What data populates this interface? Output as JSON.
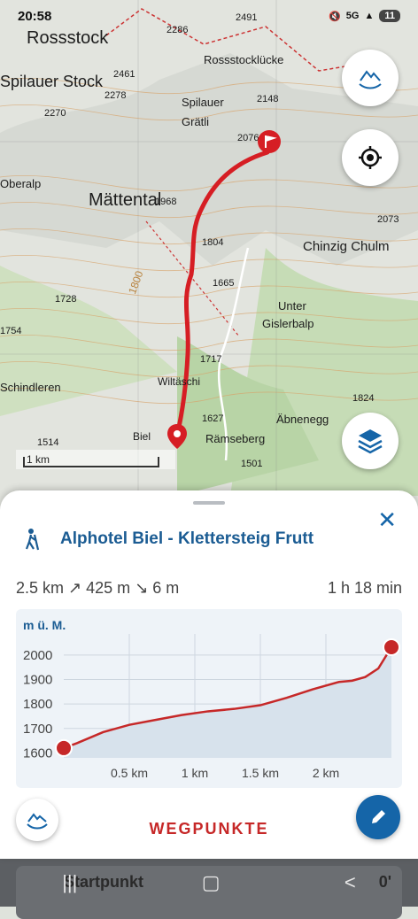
{
  "status_bar": {
    "time": "20:58",
    "network": "5G",
    "battery": "11"
  },
  "map": {
    "labels": [
      "Rossstock",
      "2461",
      "Spilauer Stock",
      "2278",
      "2270",
      "Rossstocklücke",
      "Spilauer",
      "Grätli",
      "2148",
      "2076",
      "1968",
      "Oberalp",
      "Mättental",
      "1804",
      "1800",
      "2073",
      "Chinzig Chulm",
      "1665",
      "1728",
      "Unter",
      "Gislerbalp",
      "1754",
      "1717",
      "Wiltäschi",
      "Schindleren",
      "Biel",
      "1627",
      "Rämseberg",
      "Äbnenegg",
      "1824",
      "1514",
      "1501",
      "2491",
      "2286"
    ],
    "scale_label": "1 km"
  },
  "sheet": {
    "title": "Alphotel Biel - Klettersteig Frutt",
    "distance": "2.5 km",
    "ascent": "↗ 425 m",
    "descent": "↘ 6 m",
    "duration": "1 h 18 min",
    "waypoints_label": "WEGPUNKTE"
  },
  "chart_data": {
    "type": "area",
    "ylabel": "m ü. M.",
    "x_ticks": [
      "0.5 km",
      "1 km",
      "1.5 km",
      "2 km"
    ],
    "y_ticks": [
      "1600",
      "1700",
      "1800",
      "1900",
      "2000"
    ],
    "ylim": [
      1580,
      2050
    ],
    "xlim": [
      0,
      2.5
    ],
    "x": [
      0,
      0.1,
      0.3,
      0.5,
      0.7,
      0.9,
      1.1,
      1.3,
      1.5,
      1.7,
      1.9,
      2.1,
      2.2,
      2.3,
      2.4,
      2.5
    ],
    "y": [
      1620,
      1640,
      1685,
      1715,
      1735,
      1755,
      1770,
      1780,
      1795,
      1825,
      1860,
      1890,
      1895,
      1910,
      1945,
      2032
    ],
    "color": "#c62828"
  },
  "nav": {
    "startpunkt": "Startpunkt",
    "start_value": "0'"
  }
}
